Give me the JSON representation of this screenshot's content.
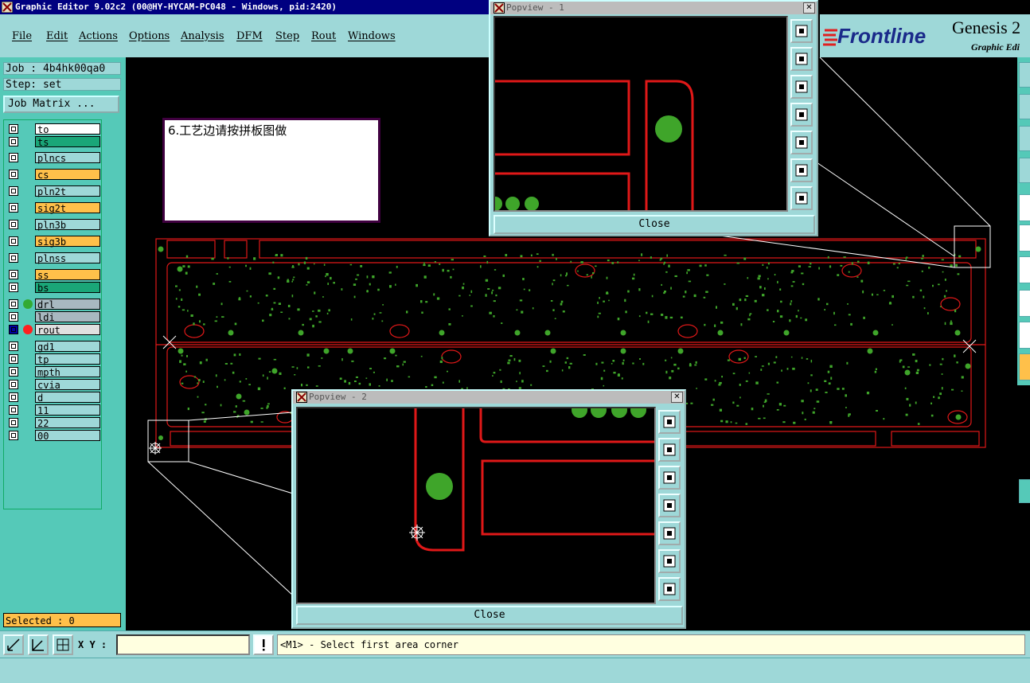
{
  "window": {
    "title": "Graphic Editor 9.02c2 (00@HY-HYCAM-PC048 - Windows, pid:2420)"
  },
  "menu": [
    "File",
    "Edit",
    "Actions",
    "Options",
    "Analysis",
    "DFM",
    "Step",
    "Rout",
    "Windows"
  ],
  "logo": {
    "brand": "Frontline",
    "product": "Genesis 2",
    "subtitle": "Graphic Edi"
  },
  "info": {
    "job": "Job : 4b4hk00qa0",
    "step": "Step: set",
    "job_matrix": "Job Matrix ..."
  },
  "layers": [
    {
      "name": "to",
      "color": "#ffffff",
      "dot": ""
    },
    {
      "name": "ts",
      "color": "#1aa678",
      "dot": ""
    },
    {
      "name": "plncs",
      "color": "#9ed8d8",
      "dot": ""
    },
    {
      "name": "cs",
      "color": "#ffc04a",
      "dot": ""
    },
    {
      "name": "pln2t",
      "color": "#9ed8d8",
      "dot": ""
    },
    {
      "name": "sig2t",
      "color": "#ffc04a",
      "dot": ""
    },
    {
      "name": "pln3b",
      "color": "#9ed8d8",
      "dot": ""
    },
    {
      "name": "sig3b",
      "color": "#ffc04a",
      "dot": ""
    },
    {
      "name": "plnss",
      "color": "#9ed8d8",
      "dot": ""
    },
    {
      "name": "ss",
      "color": "#ffc04a",
      "dot": ""
    },
    {
      "name": "bs",
      "color": "#1aa678",
      "dot": ""
    },
    {
      "name": "drl",
      "color": "#a8b8c0",
      "dot": "#33aa33"
    },
    {
      "name": "ldi",
      "color": "#a8b8c0",
      "dot": ""
    },
    {
      "name": "rout",
      "color": "#e0e0e0",
      "dot": "#ff2020"
    },
    {
      "name": "gd1",
      "color": "#9ed8d8",
      "dot": ""
    },
    {
      "name": "tp",
      "color": "#9ed8d8",
      "dot": ""
    },
    {
      "name": "mpth",
      "color": "#9ed8d8",
      "dot": ""
    },
    {
      "name": "cvia",
      "color": "#9ed8d8",
      "dot": ""
    },
    {
      "name": "d",
      "color": "#9ed8d8",
      "dot": ""
    },
    {
      "name": "11",
      "color": "#9ed8d8",
      "dot": ""
    },
    {
      "name": "22",
      "color": "#9ed8d8",
      "dot": ""
    },
    {
      "name": "00",
      "color": "#9ed8d8",
      "dot": ""
    }
  ],
  "note": {
    "text": "6.工艺边请按拼板图做"
  },
  "popview1": {
    "title": "Popview - 1",
    "close": "Close"
  },
  "popview2": {
    "title": "Popview - 2",
    "close": "Close"
  },
  "selected": "Selected : 0",
  "bottom": {
    "xy_label": "X Y :",
    "xy_value": "",
    "prompt": "<M1> - Select first area corner"
  },
  "right_labels": [
    "X",
    "Y"
  ]
}
